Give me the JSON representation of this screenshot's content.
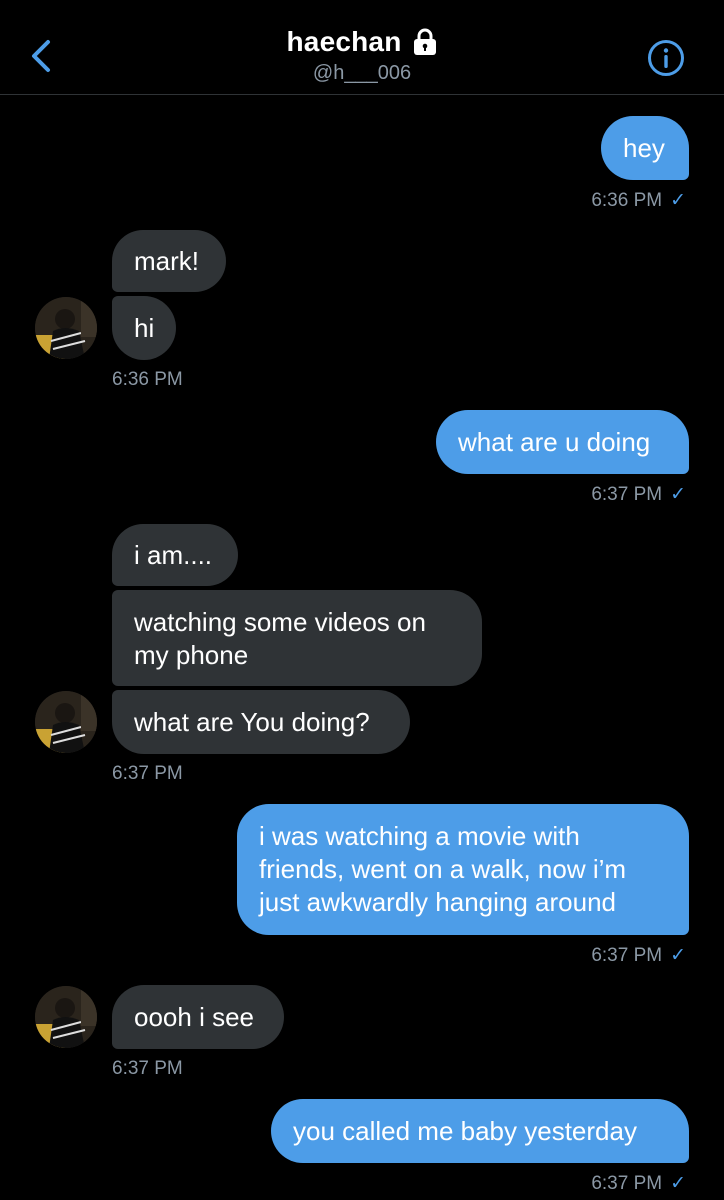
{
  "header": {
    "name": "haechan",
    "handle": "@h___006",
    "back_icon": "chevron-left-icon",
    "lock_icon": "lock-icon",
    "info_icon": "info-icon",
    "accent": "#4d9de8"
  },
  "messages": [
    {
      "side": "out",
      "text": "hey"
    },
    {
      "side": "ts_out",
      "text": "6:36 PM",
      "check": "✓"
    },
    {
      "side": "in",
      "text": "mark!"
    },
    {
      "side": "in",
      "text": "hi"
    },
    {
      "side": "ts_in",
      "text": "6:36 PM"
    },
    {
      "side": "out",
      "text": "what are u doing"
    },
    {
      "side": "ts_out",
      "text": "6:37 PM",
      "check": "✓"
    },
    {
      "side": "in",
      "text": "i am...."
    },
    {
      "side": "in",
      "text": "watching some videos on my phone"
    },
    {
      "side": "in",
      "text": "what are You doing?"
    },
    {
      "side": "ts_in",
      "text": "6:37 PM"
    },
    {
      "side": "out",
      "text": "i was watching a movie with friends, went on a walk, now i’m just awkwardly hanging around"
    },
    {
      "side": "ts_out",
      "text": "6:37 PM",
      "check": "✓"
    },
    {
      "side": "in",
      "text": "oooh i see"
    },
    {
      "side": "ts_in",
      "text": "6:37 PM"
    },
    {
      "side": "out",
      "text": "you called me baby yesterday"
    },
    {
      "side": "ts_out",
      "text": "6:37 PM",
      "check": "✓"
    }
  ],
  "colors": {
    "outgoing_bubble": "#4d9de8",
    "incoming_bubble": "#2f3336",
    "timestamp": "#8b98a5",
    "background": "#000000"
  }
}
